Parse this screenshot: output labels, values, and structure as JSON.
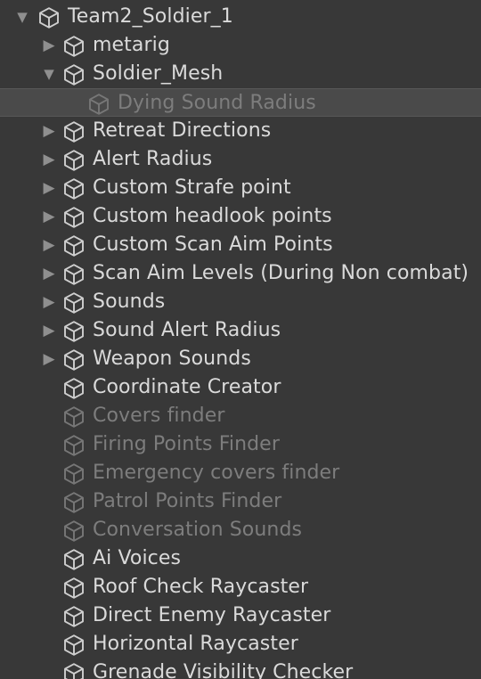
{
  "hierarchy": {
    "rows": [
      {
        "label": "Team2_Soldier_1",
        "depth": 0,
        "toggle": "expanded",
        "active": true,
        "selected": false
      },
      {
        "label": "metarig",
        "depth": 1,
        "toggle": "collapsed",
        "active": true,
        "selected": false
      },
      {
        "label": "Soldier_Mesh",
        "depth": 1,
        "toggle": "expanded",
        "active": true,
        "selected": false
      },
      {
        "label": "Dying Sound Radius",
        "depth": 2,
        "toggle": "none",
        "active": false,
        "selected": true
      },
      {
        "label": "Retreat Directions",
        "depth": 1,
        "toggle": "collapsed",
        "active": true,
        "selected": false
      },
      {
        "label": "Alert Radius",
        "depth": 1,
        "toggle": "collapsed",
        "active": true,
        "selected": false
      },
      {
        "label": "Custom Strafe point",
        "depth": 1,
        "toggle": "collapsed",
        "active": true,
        "selected": false
      },
      {
        "label": "Custom headlook points",
        "depth": 1,
        "toggle": "collapsed",
        "active": true,
        "selected": false
      },
      {
        "label": "Custom Scan Aim Points",
        "depth": 1,
        "toggle": "collapsed",
        "active": true,
        "selected": false
      },
      {
        "label": "Scan Aim Levels (During Non combat)",
        "depth": 1,
        "toggle": "collapsed",
        "active": true,
        "selected": false
      },
      {
        "label": "Sounds",
        "depth": 1,
        "toggle": "collapsed",
        "active": true,
        "selected": false
      },
      {
        "label": "Sound Alert Radius",
        "depth": 1,
        "toggle": "collapsed",
        "active": true,
        "selected": false
      },
      {
        "label": "Weapon Sounds",
        "depth": 1,
        "toggle": "collapsed",
        "active": true,
        "selected": false
      },
      {
        "label": "Coordinate Creator",
        "depth": 1,
        "toggle": "none",
        "active": true,
        "selected": false
      },
      {
        "label": "Covers finder",
        "depth": 1,
        "toggle": "none",
        "active": false,
        "selected": false
      },
      {
        "label": "Firing Points Finder",
        "depth": 1,
        "toggle": "none",
        "active": false,
        "selected": false
      },
      {
        "label": "Emergency covers finder",
        "depth": 1,
        "toggle": "none",
        "active": false,
        "selected": false
      },
      {
        "label": "Patrol Points Finder",
        "depth": 1,
        "toggle": "none",
        "active": false,
        "selected": false
      },
      {
        "label": "Conversation Sounds",
        "depth": 1,
        "toggle": "none",
        "active": false,
        "selected": false
      },
      {
        "label": "Ai Voices",
        "depth": 1,
        "toggle": "none",
        "active": true,
        "selected": false
      },
      {
        "label": "Roof Check Raycaster",
        "depth": 1,
        "toggle": "none",
        "active": true,
        "selected": false
      },
      {
        "label": "Direct Enemy Raycaster",
        "depth": 1,
        "toggle": "none",
        "active": true,
        "selected": false
      },
      {
        "label": "Horizontal Raycaster",
        "depth": 1,
        "toggle": "none",
        "active": true,
        "selected": false
      },
      {
        "label": "Grenade Visibility Checker",
        "depth": 1,
        "toggle": "none",
        "active": true,
        "selected": false
      }
    ]
  },
  "icons": {
    "expanded": "triangle-down-icon",
    "collapsed": "triangle-right-icon",
    "object": "gameobject-cube-icon"
  },
  "colors": {
    "background": "#383838",
    "selection": "#4a4a4a",
    "text_active": "#dadada",
    "text_inactive": "#7d7d7d"
  }
}
